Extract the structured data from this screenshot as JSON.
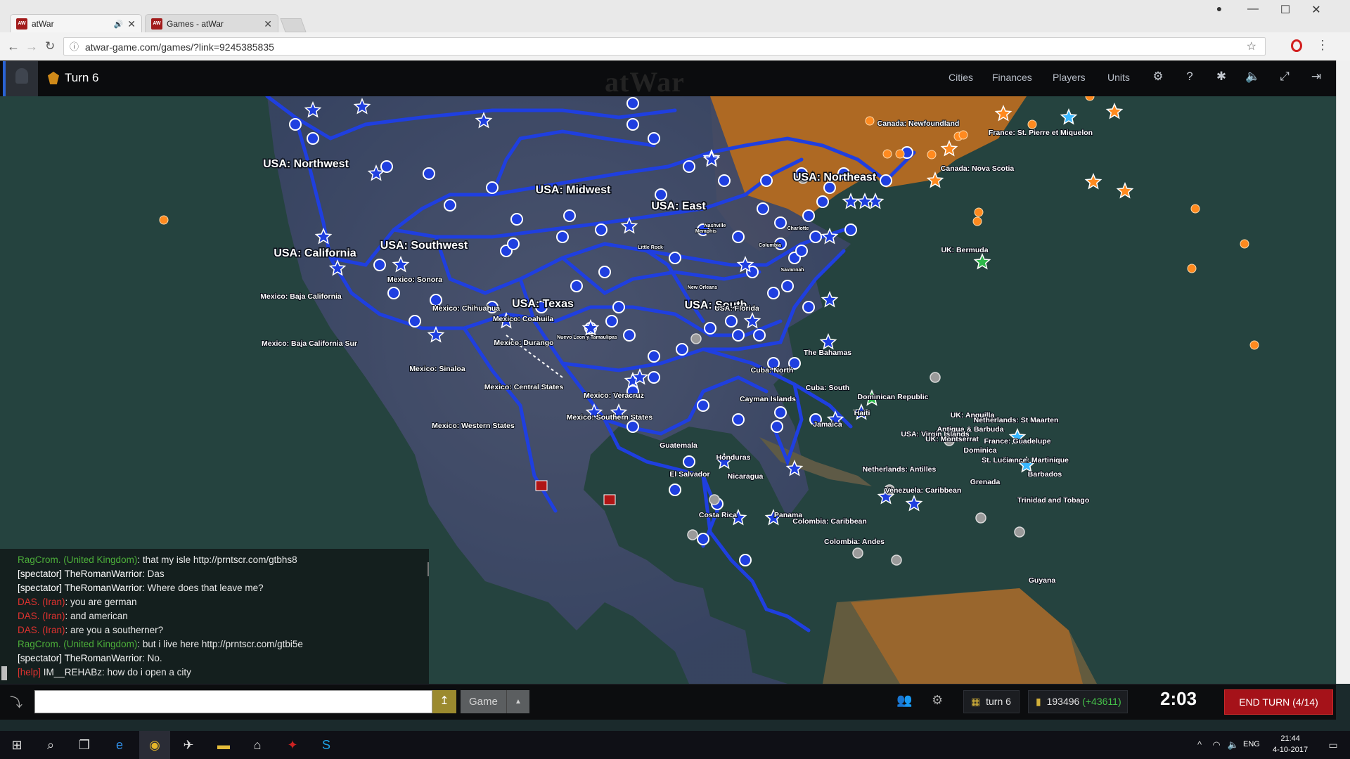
{
  "browser": {
    "tabs": [
      {
        "label": "atWar",
        "favicon": "AW"
      },
      {
        "label": "Games - atWar",
        "favicon": "AW"
      }
    ],
    "url": "atwar-game.com/games/?link=9245385835"
  },
  "game": {
    "turn_label": "Turn 6",
    "logo": "atWar",
    "nav": [
      "Cities",
      "Finances",
      "Players",
      "Units"
    ],
    "icons": [
      "settings-icon",
      "help-icon",
      "bug-icon",
      "sound-icon",
      "fullscreen-icon",
      "exit-icon"
    ]
  },
  "map": {
    "region_labels": [
      {
        "text": "USA: Northwest",
        "size": "big"
      },
      {
        "text": "USA: Midwest",
        "size": "big"
      },
      {
        "text": "USA: East",
        "size": "big"
      },
      {
        "text": "USA: Northeast",
        "size": "big"
      },
      {
        "text": "USA: California",
        "size": "big"
      },
      {
        "text": "USA: Southwest",
        "size": "big"
      },
      {
        "text": "USA: Texas",
        "size": "big"
      },
      {
        "text": "USA: South",
        "size": "big"
      },
      {
        "text": "Canada: Newfoundland",
        "size": "small"
      },
      {
        "text": "France: St. Pierre et Miquelon",
        "size": "small"
      },
      {
        "text": "Canada: Nova Scotia",
        "size": "small"
      },
      {
        "text": "UK: Bermuda",
        "size": "small"
      },
      {
        "text": "Nashville",
        "size": "tiny"
      },
      {
        "text": "Charlotte",
        "size": "tiny"
      },
      {
        "text": "Memphis",
        "size": "tiny"
      },
      {
        "text": "Little Rock",
        "size": "tiny"
      },
      {
        "text": "Columbia",
        "size": "tiny"
      },
      {
        "text": "Savannah",
        "size": "tiny"
      },
      {
        "text": "New Orleans",
        "size": "tiny"
      },
      {
        "text": "Mexico: Baja California",
        "size": "small"
      },
      {
        "text": "Mexico: Sonora",
        "size": "small"
      },
      {
        "text": "Mexico: Chihuahua",
        "size": "small"
      },
      {
        "text": "Mexico: Coahuila",
        "size": "small"
      },
      {
        "text": "USA: Florida",
        "size": "small"
      },
      {
        "text": "Mexico: Baja California Sur",
        "size": "small"
      },
      {
        "text": "Mexico: Durango",
        "size": "small"
      },
      {
        "text": "Nuevo Leon y Tamaulipas",
        "size": "tiny"
      },
      {
        "text": "The Bahamas",
        "size": "small"
      },
      {
        "text": "Mexico: Sinaloa",
        "size": "small"
      },
      {
        "text": "Cuba: North",
        "size": "small"
      },
      {
        "text": "Mexico: Central States",
        "size": "small"
      },
      {
        "text": "Mexico: Veracruz",
        "size": "small"
      },
      {
        "text": "Cuba: South",
        "size": "small"
      },
      {
        "text": "Dominican Republic",
        "size": "small"
      },
      {
        "text": "Cayman Islands",
        "size": "small"
      },
      {
        "text": "Haiti",
        "size": "small"
      },
      {
        "text": "Jamaica",
        "size": "small"
      },
      {
        "text": "Mexico: Western States",
        "size": "small"
      },
      {
        "text": "Mexico: Southern States",
        "size": "small"
      },
      {
        "text": "UK: Anguilla",
        "size": "small"
      },
      {
        "text": "Netherlands: St Maarten",
        "size": "small"
      },
      {
        "text": "Antigua & Barbuda",
        "size": "small"
      },
      {
        "text": "USA: Virgin Islands",
        "size": "small"
      },
      {
        "text": "UK: Montserrat",
        "size": "small"
      },
      {
        "text": "France: Guadelupe",
        "size": "small"
      },
      {
        "text": "Dominica",
        "size": "small"
      },
      {
        "text": "France: Martinique",
        "size": "small"
      },
      {
        "text": "St. Lucia",
        "size": "small"
      },
      {
        "text": "Barbados",
        "size": "small"
      },
      {
        "text": "Netherlands: Antilles",
        "size": "small"
      },
      {
        "text": "Grenada",
        "size": "small"
      },
      {
        "text": "Venezuela: Caribbean",
        "size": "small"
      },
      {
        "text": "Trinidad and Tobago",
        "size": "small"
      },
      {
        "text": "Guatemala",
        "size": "small"
      },
      {
        "text": "Honduras",
        "size": "small"
      },
      {
        "text": "El Salvador",
        "size": "small"
      },
      {
        "text": "Nicaragua",
        "size": "small"
      },
      {
        "text": "Costa Rica",
        "size": "small"
      },
      {
        "text": "Panama",
        "size": "small"
      },
      {
        "text": "Colombia: Caribbean",
        "size": "small"
      },
      {
        "text": "Colombia: Andes",
        "size": "small"
      },
      {
        "text": "Guyana",
        "size": "small"
      }
    ],
    "colors": {
      "player_blue": "#1f3fe0",
      "orange_player": "#ff8a1f",
      "neutral": "#9a9a9a",
      "green_player": "#2db84a",
      "cyan_player": "#3ab8ff"
    }
  },
  "chat": {
    "lines": [
      {
        "who": "RagCrom. (United Kingdom)",
        "msg": ": that my isle http://prntscr.com/gtbhs8",
        "color": "#4caf3a"
      },
      {
        "who": "[spectator] TheRomanWarrior",
        "msg": ": Das",
        "color": "#ffffff"
      },
      {
        "who": "[spectator] TheRomanWarrior",
        "msg": ": Where does that leave me?",
        "color": "#ffffff"
      },
      {
        "who": "DAS. (Iran)",
        "msg": ": you are german",
        "color": "#e0322f"
      },
      {
        "who": "DAS. (Iran)",
        "msg": ": and american",
        "color": "#e0322f"
      },
      {
        "who": "DAS. (Iran)",
        "msg": ": are you a southerner?",
        "color": "#e0322f"
      },
      {
        "who": "RagCrom. (United Kingdom)",
        "msg": ": but i live here http://prntscr.com/gtbi5e",
        "color": "#4caf3a"
      },
      {
        "who": "[spectator] TheRomanWarrior",
        "msg": ": No.",
        "color": "#ffffff"
      },
      {
        "who": "[help]",
        "msg": " IM__REHABz: how do i open a city",
        "color": "#e0322f"
      }
    ],
    "input_value": "",
    "channel": "Game"
  },
  "bottom": {
    "turn": "turn 6",
    "money": "193496",
    "income": "(+43611)",
    "timer": "2:03",
    "end_turn": "END TURN (4/14)"
  },
  "taskbar": {
    "lang": "ENG",
    "time": "21:44",
    "date": "4-10-2017"
  }
}
